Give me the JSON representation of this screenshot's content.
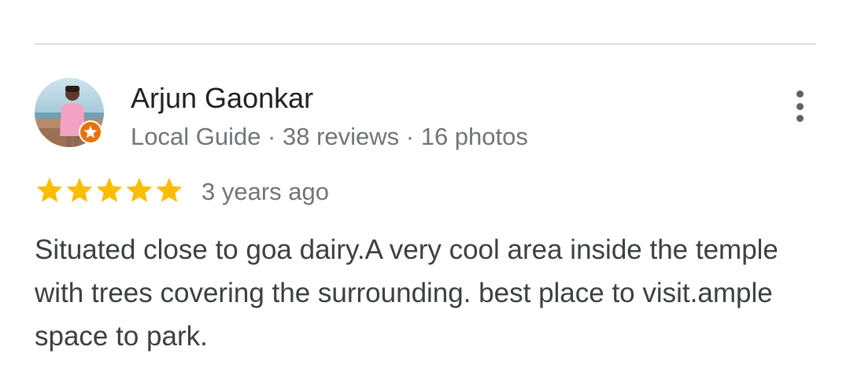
{
  "review": {
    "author": {
      "name": "Arjun Gaonkar",
      "meta": "Local Guide · 38 reviews · 16 photos",
      "avatar_icon": "user-avatar-photo",
      "badge_icon": "local-guide-star-badge"
    },
    "rating": {
      "stars": 5,
      "max_stars": 5,
      "color": "#fbbc04"
    },
    "time": "3 years ago",
    "text": "Situated close to goa dairy.A very cool area inside the temple with trees covering the surrounding. best place to visit.ample space to park.",
    "menu_icon": "more-vert-icon"
  },
  "colors": {
    "name": "#202124",
    "meta": "#70757a",
    "text": "#3c4043",
    "badge": "#e8710a",
    "divider": "#dadce0"
  }
}
